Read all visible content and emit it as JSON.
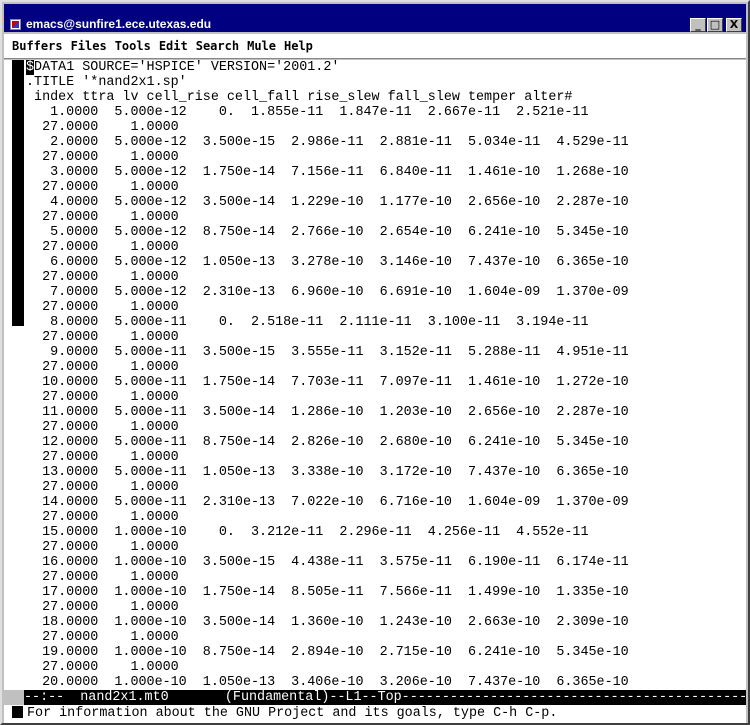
{
  "window": {
    "title": "emacs@sunfire1.ece.utexas.edu",
    "app_icon": "emacs-icon",
    "buttons": [
      "_",
      "□",
      "X"
    ]
  },
  "menubar": {
    "items": [
      "Buffers",
      "Files",
      "Tools",
      "Edit",
      "Search",
      "Mule",
      "Help"
    ]
  },
  "buffer": {
    "first_char": "$",
    "first_line_rest": "DATA1 SOURCE='HSPICE' VERSION='2001.2'",
    "lines": [
      ".TITLE '*nand2x1.sp'",
      " index ttra lv cell_rise cell_fall rise_slew fall_slew temper alter#",
      "   1.0000  5.000e-12    0.  1.855e-11  1.847e-11  2.667e-11  2.521e-11",
      "  27.0000    1.0000",
      "   2.0000  5.000e-12  3.500e-15  2.986e-11  2.881e-11  5.034e-11  4.529e-11",
      "  27.0000    1.0000",
      "   3.0000  5.000e-12  1.750e-14  7.156e-11  6.840e-11  1.461e-10  1.268e-10",
      "  27.0000    1.0000",
      "   4.0000  5.000e-12  3.500e-14  1.229e-10  1.177e-10  2.656e-10  2.287e-10",
      "  27.0000    1.0000",
      "   5.0000  5.000e-12  8.750e-14  2.766e-10  2.654e-10  6.241e-10  5.345e-10",
      "  27.0000    1.0000",
      "   6.0000  5.000e-12  1.050e-13  3.278e-10  3.146e-10  7.437e-10  6.365e-10",
      "  27.0000    1.0000",
      "   7.0000  5.000e-12  2.310e-13  6.960e-10  6.691e-10  1.604e-09  1.370e-09",
      "  27.0000    1.0000",
      "   8.0000  5.000e-11    0.  2.518e-11  2.111e-11  3.100e-11  3.194e-11",
      "  27.0000    1.0000",
      "   9.0000  5.000e-11  3.500e-15  3.555e-11  3.152e-11  5.288e-11  4.951e-11",
      "  27.0000    1.0000",
      "  10.0000  5.000e-11  1.750e-14  7.703e-11  7.097e-11  1.461e-10  1.272e-10",
      "  27.0000    1.0000",
      "  11.0000  5.000e-11  3.500e-14  1.286e-10  1.203e-10  2.656e-10  2.287e-10",
      "  27.0000    1.0000",
      "  12.0000  5.000e-11  8.750e-14  2.826e-10  2.680e-10  6.241e-10  5.345e-10",
      "  27.0000    1.0000",
      "  13.0000  5.000e-11  1.050e-13  3.338e-10  3.172e-10  7.437e-10  6.365e-10",
      "  27.0000    1.0000",
      "  14.0000  5.000e-11  2.310e-13  7.022e-10  6.716e-10  1.604e-09  1.370e-09",
      "  27.0000    1.0000",
      "  15.0000  1.000e-10    0.  3.212e-11  2.296e-11  4.256e-11  4.552e-11",
      "  27.0000    1.0000",
      "  16.0000  1.000e-10  3.500e-15  4.438e-11  3.575e-11  6.190e-11  6.174e-11",
      "  27.0000    1.0000",
      "  17.0000  1.000e-10  1.750e-14  8.505e-11  7.566e-11  1.499e-10  1.335e-10",
      "  27.0000    1.0000",
      "  18.0000  1.000e-10  3.500e-14  1.360e-10  1.243e-10  2.663e-10  2.309e-10",
      "  27.0000    1.0000",
      "  19.0000  1.000e-10  8.750e-14  2.894e-10  2.715e-10  6.241e-10  5.345e-10",
      "  27.0000    1.0000",
      "  20.0000  1.000e-10  1.050e-13  3.406e-10  3.206e-10  7.437e-10  6.365e-10"
    ]
  },
  "modeline": "--:--  nand2x1.mt0       (Fundamental)--L1--Top-----------------------------------------------------",
  "minibuffer": "For information about the GNU Project and its goals, type C-h C-p."
}
